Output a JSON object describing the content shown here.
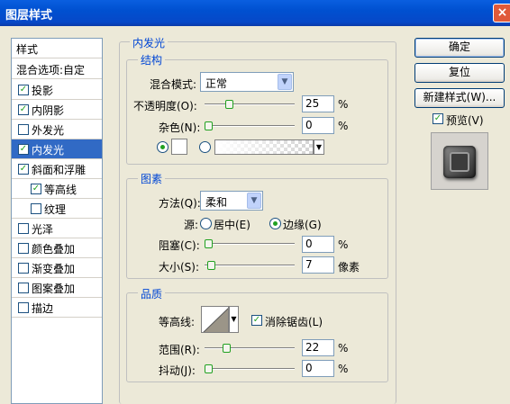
{
  "window": {
    "title": "图层样式",
    "close_glyph": "×"
  },
  "styles_list": {
    "header": "样式",
    "blend_options": "混合选项:自定",
    "items": [
      {
        "label": "投影",
        "checked": true,
        "selected": false,
        "sub": false
      },
      {
        "label": "内阴影",
        "checked": true,
        "selected": false,
        "sub": false
      },
      {
        "label": "外发光",
        "checked": false,
        "selected": false,
        "sub": false
      },
      {
        "label": "内发光",
        "checked": true,
        "selected": true,
        "sub": false
      },
      {
        "label": "斜面和浮雕",
        "checked": true,
        "selected": false,
        "sub": false
      },
      {
        "label": "等高线",
        "checked": true,
        "selected": false,
        "sub": true
      },
      {
        "label": "纹理",
        "checked": false,
        "selected": false,
        "sub": true
      },
      {
        "label": "光泽",
        "checked": false,
        "selected": false,
        "sub": false
      },
      {
        "label": "颜色叠加",
        "checked": false,
        "selected": false,
        "sub": false
      },
      {
        "label": "渐变叠加",
        "checked": false,
        "selected": false,
        "sub": false
      },
      {
        "label": "图案叠加",
        "checked": false,
        "selected": false,
        "sub": false
      },
      {
        "label": "描边",
        "checked": false,
        "selected": false,
        "sub": false
      }
    ]
  },
  "panel_title": "内发光",
  "structure": {
    "title": "结构",
    "blend_mode_label": "混合模式:",
    "blend_mode_value": "正常",
    "opacity_label": "不透明度(O):",
    "opacity_value": "25",
    "opacity_level_pct": 25,
    "noise_label": "杂色(N):",
    "noise_value": "0",
    "noise_level_pct": 0,
    "unit_pct": "%"
  },
  "elements": {
    "title": "图素",
    "method_label": "方法(Q):",
    "method_value": "柔和",
    "source_label": "源:",
    "source_center": "居中(E)",
    "source_edge": "边缘(G)",
    "choke_label": "阻塞(C):",
    "choke_value": "0",
    "choke_level_pct": 0,
    "size_label": "大小(S):",
    "size_value": "7",
    "size_level_pct": 3,
    "unit_pct": "%",
    "unit_px": "像素"
  },
  "quality": {
    "title": "品质",
    "contour_label": "等高线:",
    "antialias_label": "消除锯齿(L)",
    "range_label": "范围(R):",
    "range_value": "22",
    "range_level_pct": 22,
    "jitter_label": "抖动(J):",
    "jitter_value": "0",
    "jitter_level_pct": 0,
    "unit_pct": "%"
  },
  "buttons": {
    "ok": "确定",
    "reset": "复位",
    "new_style": "新建样式(W)...",
    "preview": "预览(V)"
  },
  "icons": {
    "dropdown": "▼",
    "check": "✓"
  }
}
